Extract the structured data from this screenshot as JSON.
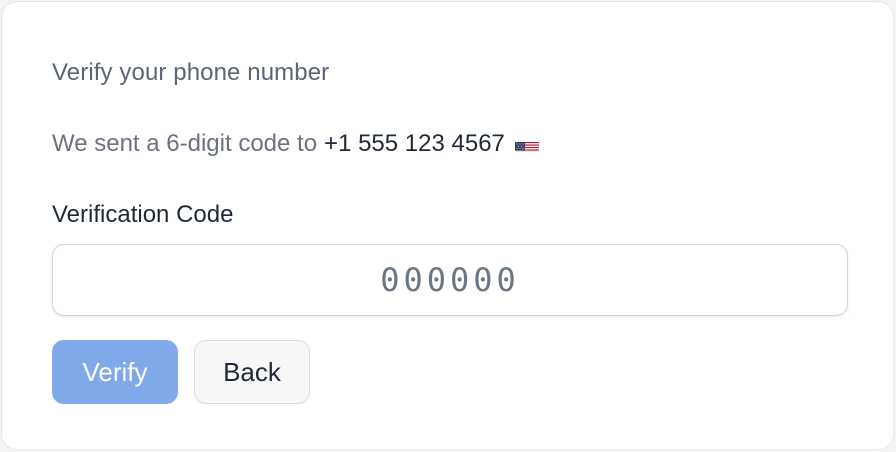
{
  "card": {
    "title": "Verify your phone number",
    "sent_prefix": "We sent a 6-digit code to",
    "phone_number": "+1 555 123 4567",
    "flag_icon": "us-flag-icon"
  },
  "form": {
    "code_label": "Verification Code",
    "code_value": "",
    "code_placeholder": "000000"
  },
  "actions": {
    "verify_label": "Verify",
    "back_label": "Back"
  },
  "colors": {
    "verify_button": "#7fa9e9",
    "back_button": "#f7f7f8",
    "title_text": "#5b6675"
  }
}
